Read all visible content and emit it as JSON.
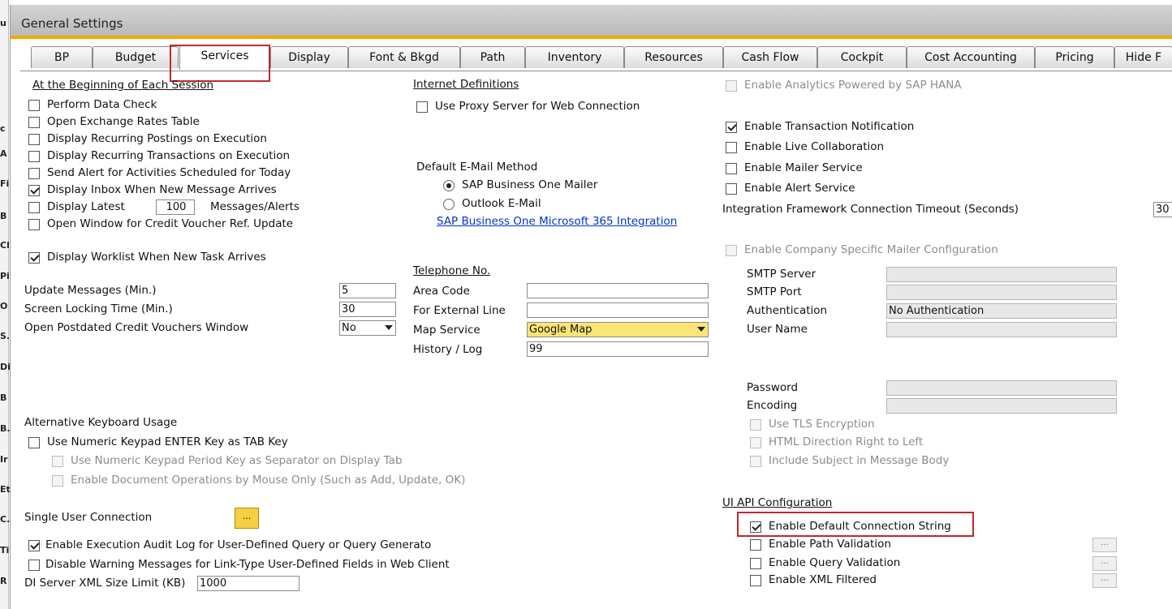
{
  "window": {
    "title": "General Settings"
  },
  "left_strip": [
    "u",
    "c",
    "A",
    "Fi",
    "B",
    "Cl",
    "Pi",
    "O",
    "S.",
    "Di",
    "B",
    "B.",
    "Ir",
    "Et",
    "C.",
    "Ti",
    "R"
  ],
  "tabs": [
    "BP",
    "Budget",
    "Services",
    "Display",
    "Font & Bkgd",
    "Path",
    "Inventory",
    "Resources",
    "Cash Flow",
    "Cockpit",
    "Cost Accounting",
    "Pricing",
    "Hide F"
  ],
  "session": {
    "heading": "At the Beginning of Each Session",
    "perform_data_check": "Perform Data Check",
    "open_exchange_rates": "Open Exchange Rates Table",
    "display_recurring_postings": "Display Recurring Postings on Execution",
    "display_recurring_transactions": "Display Recurring Transactions on Execution",
    "send_alert": "Send Alert for Activities Scheduled for Today",
    "display_inbox": "Display Inbox When New Message Arrives",
    "display_latest": "Display Latest",
    "display_latest_value": "100",
    "messages_alerts": "Messages/Alerts",
    "open_window_credit": "Open Window for Credit Voucher Ref. Update",
    "display_worklist": "Display Worklist When New Task Arrives"
  },
  "fields": {
    "update_messages_label": "Update Messages (Min.)",
    "update_messages_value": "5",
    "screen_locking_label": "Screen Locking Time (Min.)",
    "screen_locking_value": "30",
    "open_postdated_label": "Open Postdated Credit Vouchers Window",
    "open_postdated_value": "No"
  },
  "keyboard": {
    "heading": "Alternative Keyboard Usage",
    "numeric_enter": "Use Numeric Keypad ENTER Key as TAB Key",
    "numeric_period": "Use Numeric Keypad Period Key as Separator on Display Tab",
    "mouse_only": "Enable Document Operations by Mouse Only (Such as Add, Update, OK)"
  },
  "single_user": {
    "label": "Single User Connection",
    "button": "..."
  },
  "audit": {
    "execution_audit": "Enable Execution Audit Log for User-Defined Query or Query Generato",
    "disable_warning": "Disable Warning Messages for Link-Type User-Defined Fields in Web Client",
    "di_server_label": "DI Server XML Size Limit (KB)",
    "di_server_value": "1000"
  },
  "internet": {
    "heading": "Internet Definitions",
    "use_proxy": "Use Proxy Server for Web Connection",
    "email_method_label": "Default E-Mail Method",
    "sap_mailer": "SAP Business One Mailer",
    "outlook": "Outlook E-Mail",
    "ms365_link": "SAP Business One Microsoft 365 Integration"
  },
  "telephone": {
    "heading": "Telephone No.",
    "area_code": "Area Code",
    "external_line": "For External Line",
    "map_service": "Map Service",
    "map_service_value": "Google Map",
    "history_log": "History / Log",
    "history_log_value": "99"
  },
  "right": {
    "analytics_hana": "Enable Analytics Powered by SAP HANA",
    "transaction_notification": "Enable Transaction Notification",
    "live_collaboration": "Enable Live Collaboration",
    "mailer_service": "Enable Mailer Service",
    "alert_service": "Enable Alert Service",
    "integration_timeout_label": "Integration Framework Connection Timeout (Seconds)",
    "integration_timeout_value": "30",
    "company_mailer": "Enable Company Specific Mailer Configuration",
    "smtp_server": "SMTP Server",
    "smtp_port": "SMTP Port",
    "authentication": "Authentication",
    "authentication_value": "No Authentication",
    "user_name": "User Name",
    "password": "Password",
    "encoding": "Encoding",
    "use_tls": "Use TLS Encryption",
    "html_direction": "HTML Direction Right to Left",
    "include_subject": "Include Subject in Message Body"
  },
  "ui_api": {
    "heading": "UI API Configuration",
    "default_connection": "Enable Default Connection String",
    "path_validation": "Enable Path Validation",
    "query_validation": "Enable Query Validation",
    "xml_filtered": "Enable XML Filtered",
    "ellipsis": "..."
  },
  "colors": {
    "accent_bar": "#f0ab00",
    "highlight": "#c0282d",
    "link": "#0033cc",
    "map_field": "#fbe577"
  }
}
